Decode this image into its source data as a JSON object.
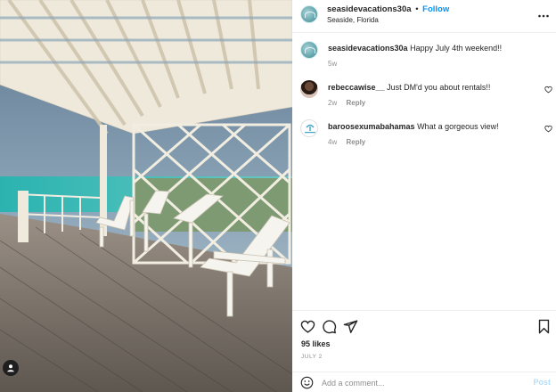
{
  "post": {
    "photo_alt": "photo",
    "header": {
      "username": "seasidevacations30a",
      "separator": "•",
      "follow_label": "Follow",
      "location": "Seaside, Florida",
      "more_icon": "more-horizontal-icon"
    },
    "caption": {
      "username": "seasidevacations30a",
      "text": "Happy July 4th weekend!!",
      "time": "5w"
    },
    "comments": [
      {
        "username": "rebeccawise__",
        "text": "Just DM'd you about rentals!!",
        "time": "2w",
        "reply_label": "Reply"
      },
      {
        "username": "baroosexumabahamas",
        "text": "What a gorgeous view!",
        "time": "4w",
        "reply_label": "Reply"
      }
    ],
    "likes": "95 likes",
    "date": "JULY 2",
    "add_comment": {
      "placeholder": "Add a comment...",
      "post_label": "Post"
    }
  },
  "colors": {
    "accent": "#0095f6",
    "muted": "#8e8e8e",
    "text": "#262626",
    "post_disabled": "#b2dffc"
  }
}
